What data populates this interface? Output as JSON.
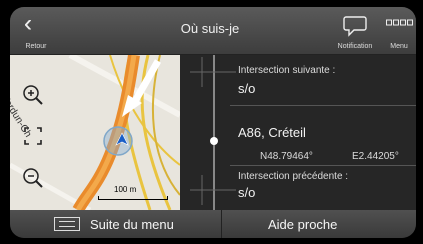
{
  "header": {
    "back_label": "Retour",
    "title": "Où suis-je",
    "notification_label": "Notification",
    "menu_label": "Menu"
  },
  "map": {
    "street_name": "Verdun-Ch",
    "scale_label": "100 m"
  },
  "info": {
    "next_intersection_label": "Intersection suivante :",
    "next_intersection_value": "s/o",
    "current_road": "A86, Créteil",
    "latitude": "N48.79464°",
    "longitude": "E2.44205°",
    "previous_intersection_label": "Intersection précédente :",
    "previous_intersection_value": "s/o"
  },
  "bottom": {
    "more_menu_label": "Suite du menu",
    "nearby_help_label": "Aide proche"
  }
}
